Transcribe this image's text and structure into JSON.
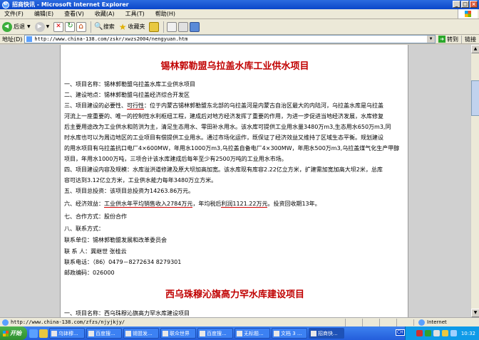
{
  "window": {
    "title": "招商快讯 - Microsoft Internet Explorer",
    "controls": [
      "_",
      "□",
      "×"
    ]
  },
  "menu": [
    "文件(F)",
    "编辑(E)",
    "查看(V)",
    "收藏(A)",
    "工具(T)",
    "帮助(H)"
  ],
  "toolbar": {
    "back": "后退",
    "search": "搜索",
    "favorites": "收藏夹"
  },
  "address": {
    "label": "地址(D)",
    "url": "http://www.china-138.com/zskr/xwzs2004/nengyuan.htm",
    "go": "转到",
    "links": "链接"
  },
  "article": {
    "title1": "锡林郭勒盟乌拉盖水库工业供水项目",
    "l1": "一、项目名称：锡林郭勒盟乌拉盖水库工业供水项目",
    "l2": "二、建设地点：锡林郭勒盟乌拉盖经济综合开发区",
    "l3a": "三、项目建设的必要性、",
    "l3b": "可行性",
    "l3c": "：位于内蒙古锡林郭勒盟东北部的乌拉盖河是内蒙古自治区最大的内陆河，乌拉盖水库是乌拉盖",
    "l4": "河流上一座重要的、唯一的控制性水利枢纽工程，建成后对地方经济发挥了重要的作用，为进一步促进当地经济发展，水库修复",
    "l5": "后主要用途改为工业供水和防洪为主，清足生态用水、零田补水用水。该水库可提供工业用水量3480万m3,生态用水650万m3,同",
    "l6": "时水库也可以为周边地区的工业项目有偿提供工业用水。通过市场化运作，既保证了经济效益又维持了区域生态平衡。规划建设",
    "l7": "的用水项目有乌拉盖抗口电厂4×600MW，年用水1000万m3,乌拉盖自备电厂4×300MW，年用水500万m3,乌拉盖煤气化生产甲醇",
    "l8": "项目，年用水1000万吨，三项合计该水库建成后每年至少有2500万吨的工业用水市场。",
    "l9": "四、项目建设内容及规模：水库溢洪道修建及原大坝加高加宽。该水库现有库容2.22亿立方米，扩建需加宽加高大坝2米，总库",
    "l10": "容可达到3.12亿立方米，工业供水能力每年3480万立方米。",
    "l11": "五、项目总投资：该项目总投资为14263.86万元。",
    "l12a": "六、经济效益：",
    "l12b": "工业供水年平均销售收入2784万元",
    "l12c": "，年均税后",
    "l12d": "利润1121.22万元",
    "l12e": "。投资回收期13年。",
    "l13": "七、合作方式：股份合作",
    "l14": "八、联系方式：",
    "l15": "联系单位：锡林郭勒盟发展和改革委员会",
    "l16": "联 系 人：冀继世 张桂云",
    "l17": "联系电话：（86）0479－8272634 8279301",
    "l18": "邮政编码：026000",
    "title2": "西乌珠穆沁旗高力罕水库建设项目",
    "l19": "一、项目名称：西乌珠穆沁旗高力罕水库建设项目"
  },
  "status": {
    "text": "http://www.china-138.com/zfzs/njyjkjy/",
    "zone": "Internet"
  },
  "taskbar": {
    "start": "开始",
    "tasks": [
      "乌钵穆...",
      "百度搜...",
      "锡盟发...",
      "联众世界",
      "百度搜...",
      "无标题...",
      "文档 3 ...",
      "招商快..."
    ],
    "lang": "CH",
    "clock": "10:32"
  },
  "colors": {
    "title_red": "#c00000",
    "underline_red": "#d00000",
    "xp_blue": "#245edb"
  }
}
